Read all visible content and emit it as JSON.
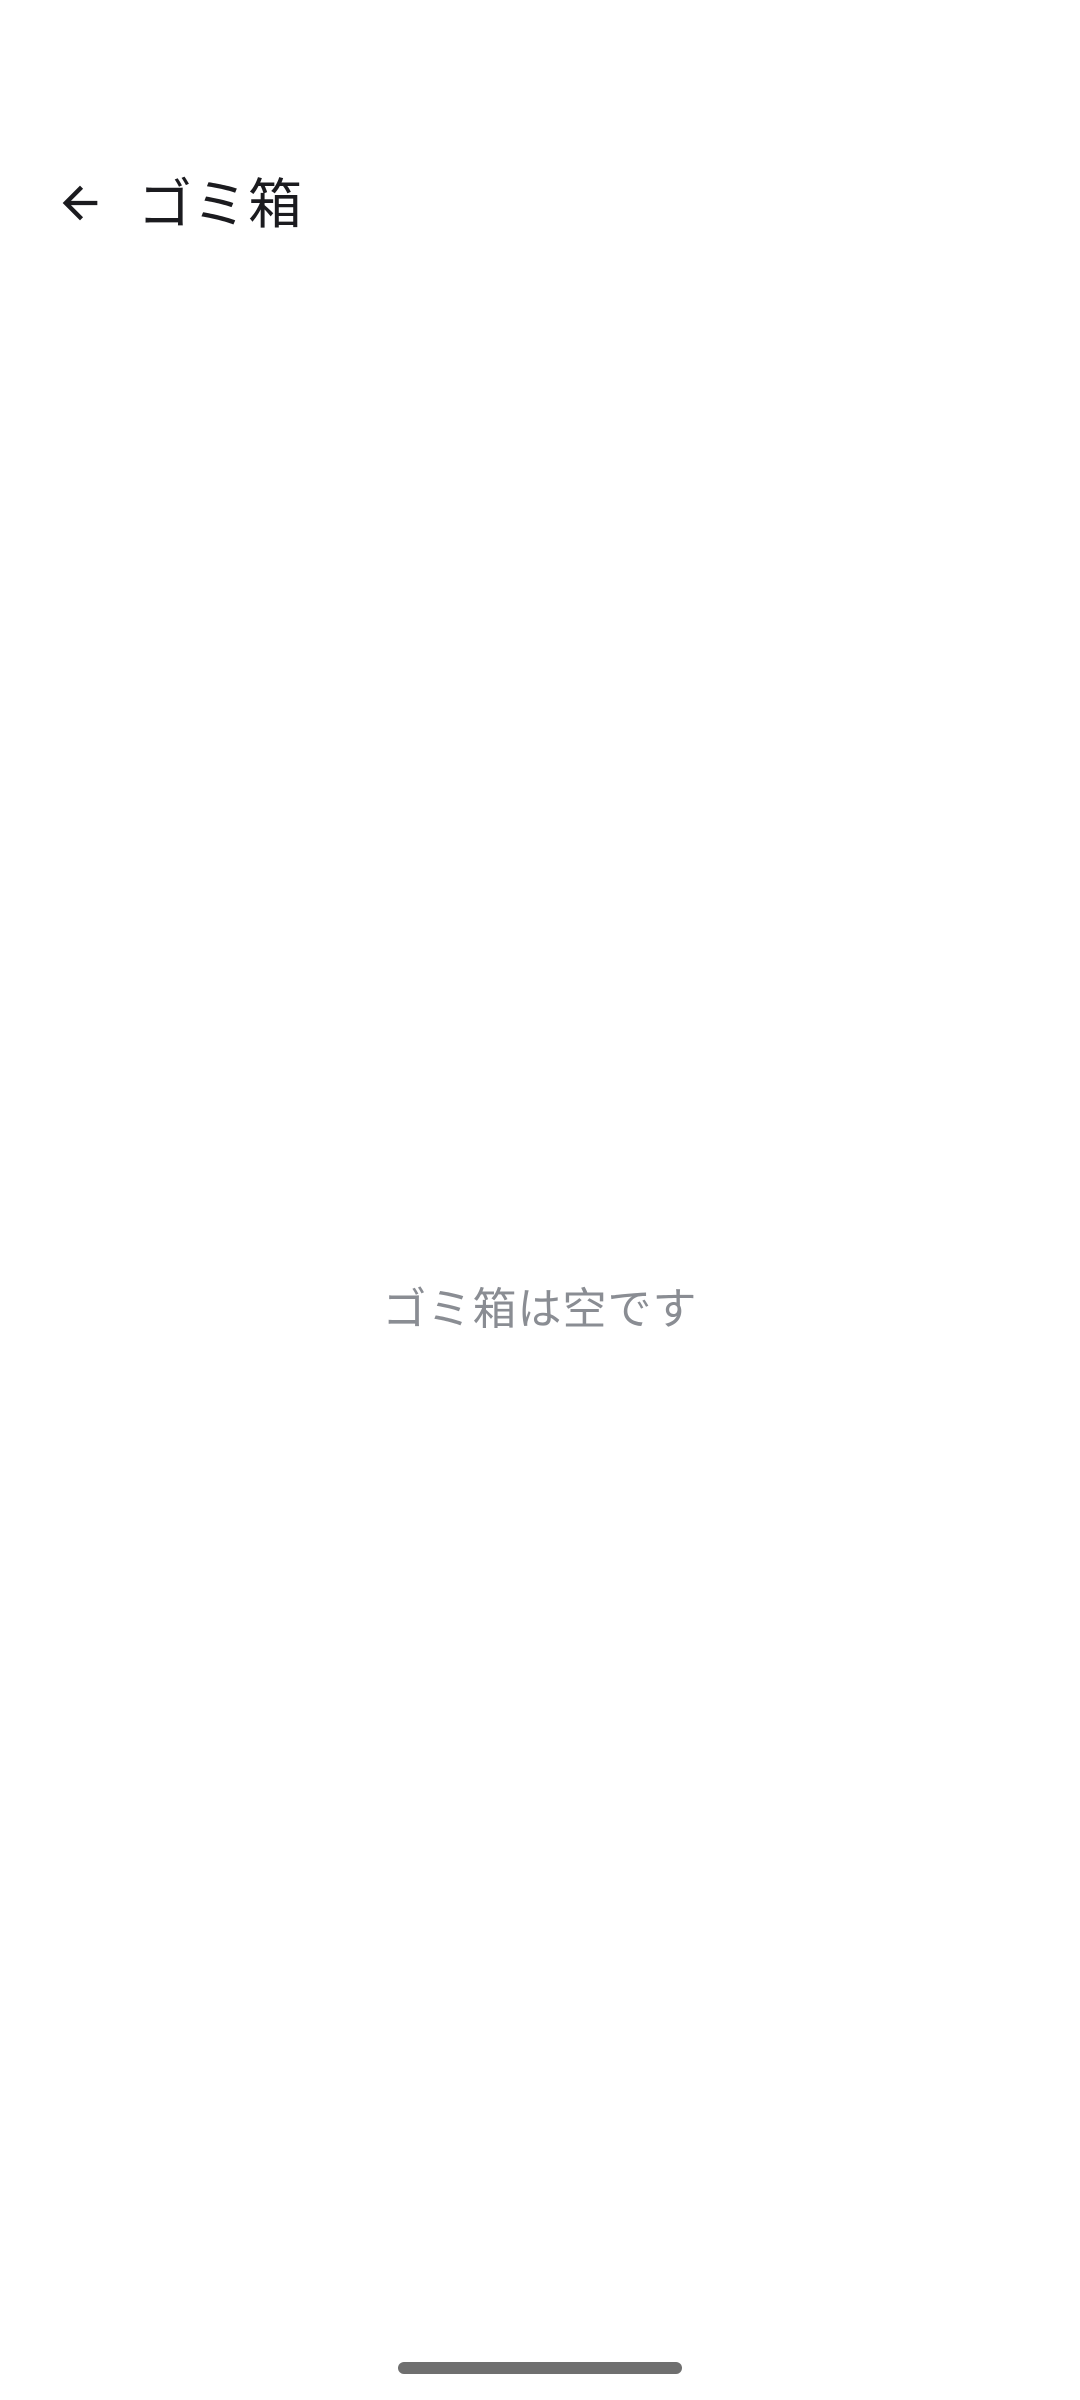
{
  "app_bar": {
    "back_icon": "arrow-back-icon",
    "title": "ゴミ箱"
  },
  "main": {
    "empty_message": "ゴミ箱は空です"
  },
  "colors": {
    "background": "#ffffff",
    "title_text": "#1b1b1f",
    "empty_text": "#8a8d93",
    "gesture_bar": "#6f6f6f"
  }
}
